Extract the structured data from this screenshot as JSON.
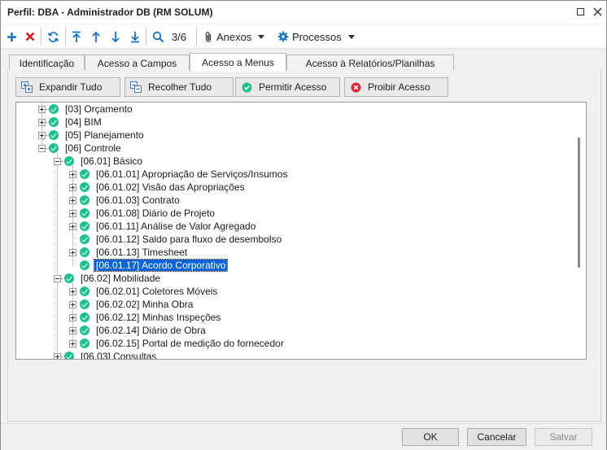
{
  "window": {
    "title": "Perfil: DBA - Administrador DB (RM SOLUM)"
  },
  "toolbar": {
    "record_position": "3/6",
    "attachments_label": "Anexos",
    "processes_label": "Processos"
  },
  "tabs": [
    {
      "label": "Identificação",
      "active": false
    },
    {
      "label": "Acesso a Campos",
      "active": false
    },
    {
      "label": "Acesso a Menus",
      "active": true
    },
    {
      "label": "Acesso à Relatórios/Planilhas",
      "active": false
    }
  ],
  "actions": {
    "expand_all": "Expandir Tudo",
    "collapse_all": "Recolher Tudo",
    "allow_access": "Permitir Acesso",
    "deny_access": "Proibir Acesso"
  },
  "tree": [
    {
      "label": "[03] Orçamento",
      "state": "collapsed"
    },
    {
      "label": "[04] BIM",
      "state": "collapsed"
    },
    {
      "label": "[05] Planejamento",
      "state": "collapsed"
    },
    {
      "label": "[06] Controle",
      "state": "expanded"
    },
    {
      "label": "[06.01] Básico",
      "state": "expanded"
    },
    {
      "label": "[06.01.01] Apropriação de Serviços/Insumos",
      "state": "collapsed"
    },
    {
      "label": "[06.01.02] Visão das Apropriações",
      "state": "collapsed"
    },
    {
      "label": "[06.01.03] Contrato",
      "state": "collapsed"
    },
    {
      "label": "[06.01.08] Diário de Projeto",
      "state": "collapsed"
    },
    {
      "label": "[06.01.11] Análise de Valor Agregado",
      "state": "collapsed"
    },
    {
      "label": "[06.01.12] Saldo para fluxo de desembolso",
      "state": "leaf"
    },
    {
      "label": "[06.01.13] Timesheet",
      "state": "collapsed"
    },
    {
      "label": "[06.01.17] Acordo Corporativo",
      "state": "leaf",
      "selected": true
    },
    {
      "label": "[06.02] Mobilidade",
      "state": "expanded"
    },
    {
      "label": "[06.02.01] Coletores Móveis",
      "state": "collapsed"
    },
    {
      "label": "[06.02.02] Minha Obra",
      "state": "collapsed"
    },
    {
      "label": "[06.02.12] Minhas Inspeções",
      "state": "collapsed"
    },
    {
      "label": "[06.02.14] Diário de Obra",
      "state": "collapsed"
    },
    {
      "label": "[06.02.15] Portal de medição do fornecedor",
      "state": "collapsed"
    },
    {
      "label": "[06.03] Consultas",
      "state": "collapsed"
    }
  ],
  "footer": {
    "ok": "OK",
    "cancel": "Cancelar",
    "save": "Salvar"
  },
  "colors": {
    "check_green": "#1fbf8f",
    "delete_red": "#d11a2a",
    "selection_blue": "#0a64d6",
    "toolbar_blue": "#1e73be"
  }
}
